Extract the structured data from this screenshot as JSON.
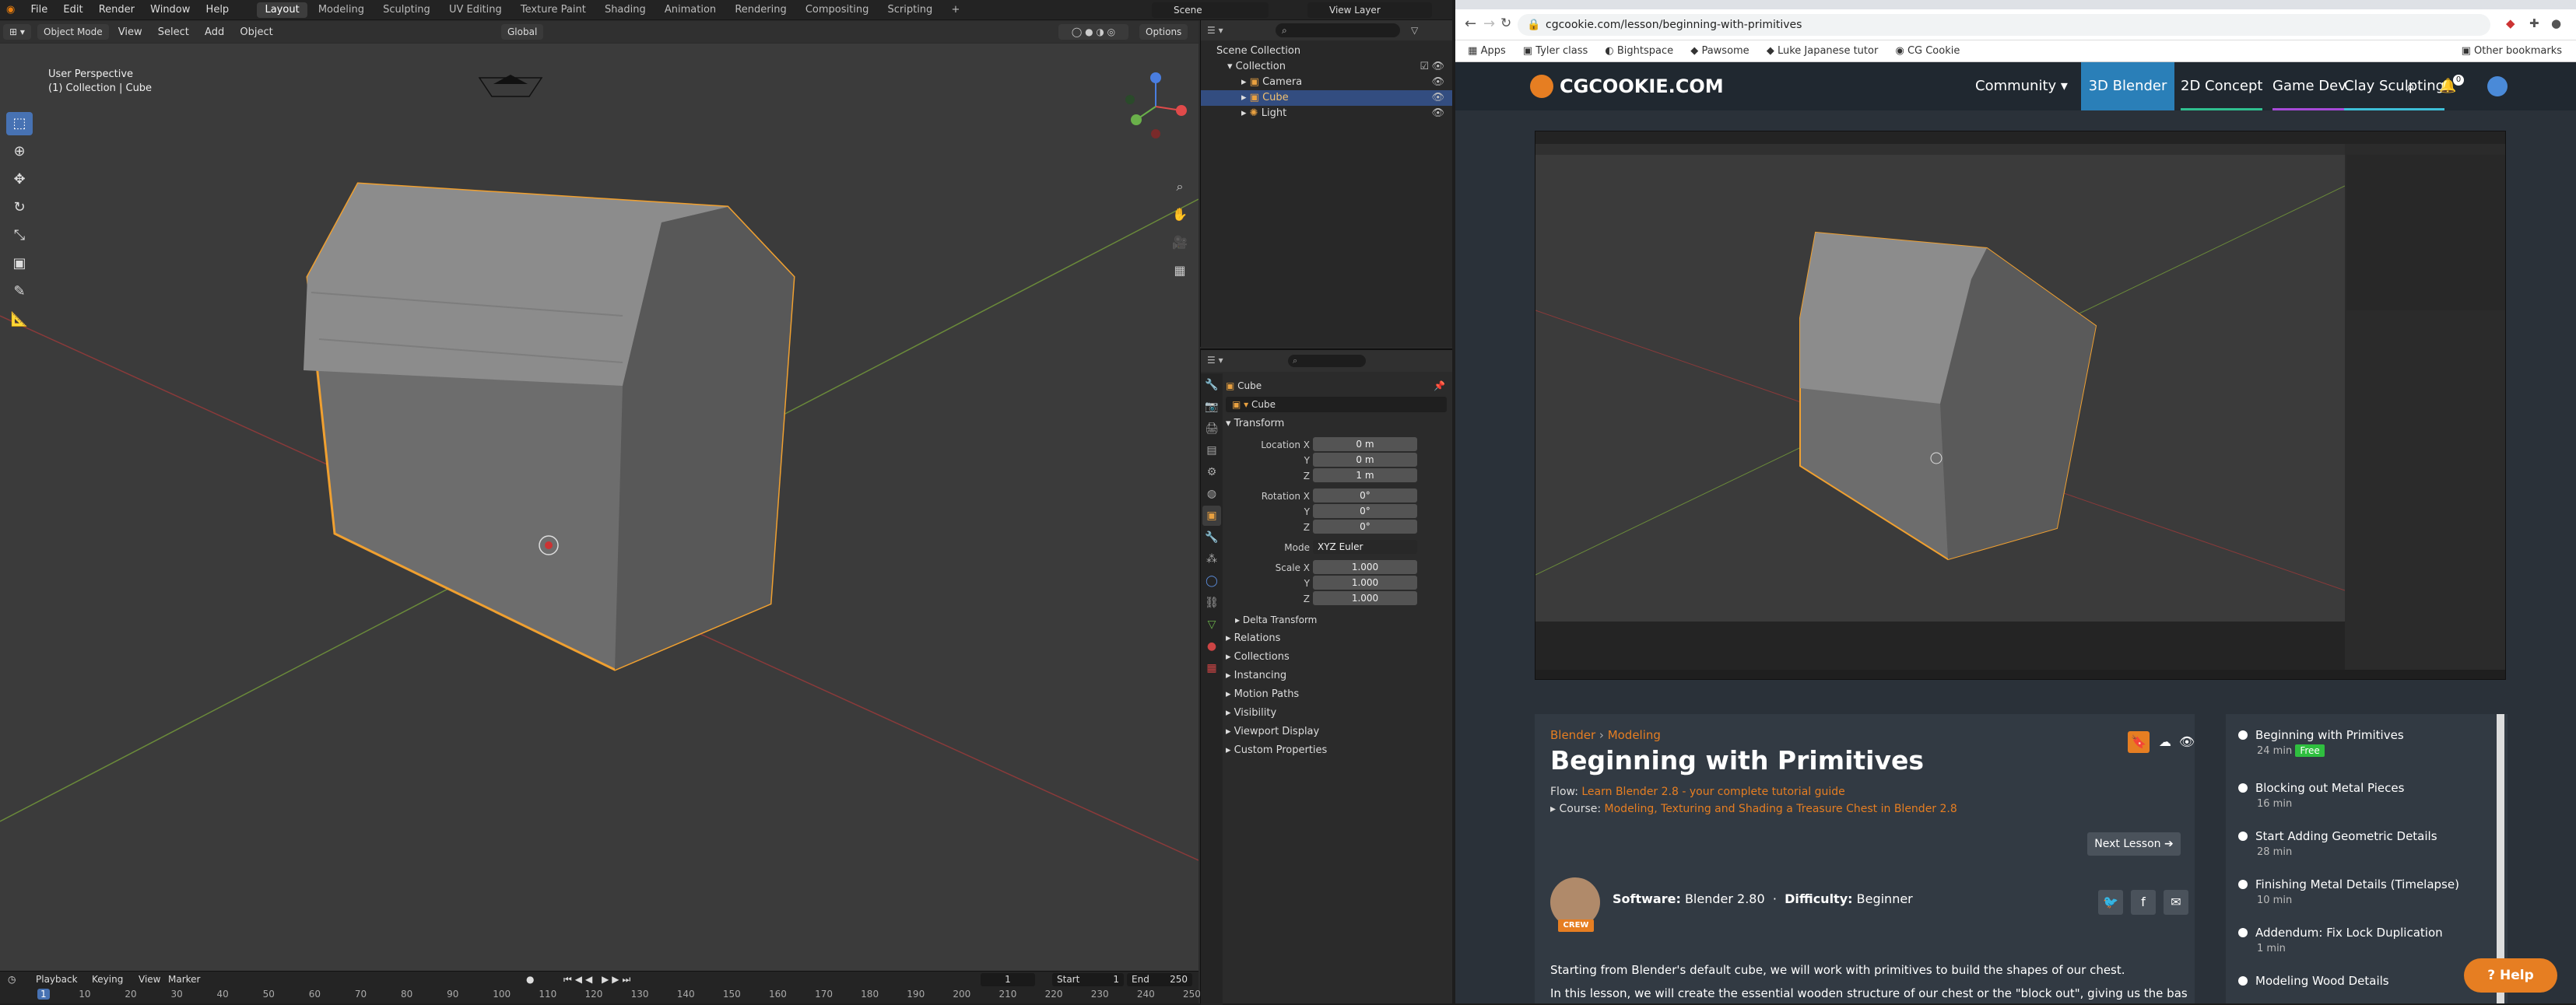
{
  "blender": {
    "menu": [
      "File",
      "Edit",
      "Render",
      "Window",
      "Help"
    ],
    "workspaces": [
      "Layout",
      "Modeling",
      "Sculpting",
      "UV Editing",
      "Texture Paint",
      "Shading",
      "Animation",
      "Rendering",
      "Compositing",
      "Scripting"
    ],
    "active_workspace": "Layout",
    "scene": "Scene",
    "view_layer": "View Layer",
    "header": {
      "mode": "Object Mode",
      "view": "View",
      "select": "Select",
      "add": "Add",
      "object": "Object",
      "orientation": "Global",
      "options": "Options"
    },
    "viewport": {
      "perspective": "User Perspective",
      "collection": "(1) Collection | Cube"
    },
    "outliner": {
      "root": "Scene Collection",
      "collection": "Collection",
      "items": [
        "Camera",
        "Cube",
        "Light"
      ],
      "selected": "Cube"
    },
    "properties": {
      "object": "Cube",
      "datablock": "Cube",
      "panel": "Transform",
      "location": {
        "label": "Location X",
        "x": "0 m",
        "y": "0 m",
        "z": "1 m"
      },
      "rotation": {
        "label": "Rotation X",
        "x": "0°",
        "y": "0°",
        "z": "0°"
      },
      "mode": {
        "label": "Mode",
        "value": "XYZ Euler"
      },
      "scale": {
        "label": "Scale X",
        "x": "1.000",
        "y": "1.000",
        "z": "1.000"
      },
      "y_label": "Y",
      "z_label": "Z",
      "sub_panels": [
        "Delta Transform",
        "Relations",
        "Collections",
        "Instancing",
        "Motion Paths",
        "Visibility",
        "Viewport Display",
        "Custom Properties"
      ]
    },
    "timeline": {
      "playback": "Playback",
      "keying": "Keying",
      "view": "View",
      "marker": "Marker",
      "current": "1",
      "start_label": "Start",
      "start": "1",
      "end_label": "End",
      "end": "250",
      "ticks": [
        "1",
        "10",
        "20",
        "30",
        "40",
        "50",
        "60",
        "70",
        "80",
        "90",
        "100",
        "110",
        "120",
        "130",
        "140",
        "150",
        "160",
        "170",
        "180",
        "190",
        "200",
        "210",
        "220",
        "230",
        "240",
        "250"
      ]
    }
  },
  "browser": {
    "url": "cgcookie.com/lesson/beginning-with-primitives",
    "bookmarks": [
      "Apps",
      "Tyler class",
      "Bightspace",
      "Pawsome",
      "Luke Japanese tutor",
      "CG Cookie",
      "Other bookmarks"
    ],
    "site": {
      "logo": "CGCOOKIE.COM",
      "nav": [
        "Community ▾",
        "3D Blender",
        "2D Concept",
        "Game Dev",
        "Clay Sculpting"
      ],
      "notif_count": "0"
    },
    "lesson": {
      "crumb1": "Blender",
      "crumb_sep": "›",
      "crumb2": "Modeling",
      "title": "Beginning with Primitives",
      "flow_label": "Flow:",
      "flow": "Learn Blender 2.8 - your complete tutorial guide",
      "course_label": "Course:",
      "course": "Modeling, Texturing and Shading a Treasure Chest in Blender 2.8",
      "next": "Next Lesson",
      "software_label": "Software:",
      "software": "Blender 2.80",
      "difficulty_label": "Difficulty:",
      "difficulty": "Beginner",
      "badge": "CREW",
      "desc1": "Starting from Blender's default cube, we will work with primitives to build the shapes of our chest.",
      "desc2": "In this lesson, we will create the essential wooden structure of our chest or the \"block out\", giving us the basic shape to"
    },
    "lessons": [
      {
        "title": "Beginning with Primitives",
        "time": "24 min",
        "badge": "Free"
      },
      {
        "title": "Blocking out Metal Pieces",
        "time": "16 min"
      },
      {
        "title": "Start Adding Geometric Details",
        "time": "28 min"
      },
      {
        "title": "Finishing Metal Details (Timelapse)",
        "time": "10 min"
      },
      {
        "title": "Addendum: Fix Lock Duplication",
        "time": "1 min"
      },
      {
        "title": "Modeling Wood Details",
        "time": ""
      }
    ],
    "help": "Help",
    "colors": {
      "accent": "#e67e22",
      "nav_active": "#2a7fb8",
      "blender_select": "#4772b3",
      "outline": "#f0a030"
    }
  }
}
